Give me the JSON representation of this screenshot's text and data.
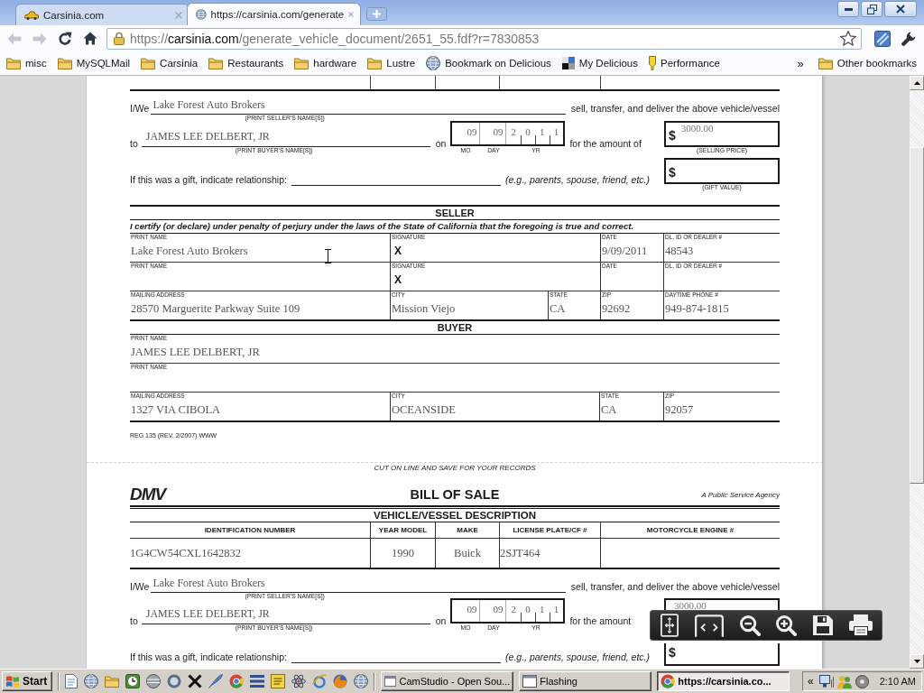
{
  "browser": {
    "tabs": [
      {
        "title": "Carsinia.com",
        "kind": "car",
        "selected": false
      },
      {
        "title": "https://carsinia.com/generate",
        "kind": "globe",
        "selected": true
      }
    ],
    "navigation": {
      "back": {
        "disabled": true
      },
      "forward": {
        "disabled": true
      }
    },
    "address": {
      "scheme": "https://",
      "host": "carsinia.com",
      "path": "/generate_vehicle_document/2651_55.fdf?r=7830853"
    },
    "bookmarks": [
      {
        "label": "misc",
        "kind": "folder"
      },
      {
        "label": "MySQLMail",
        "kind": "folder"
      },
      {
        "label": "Carsinia",
        "kind": "folder"
      },
      {
        "label": "Restaurants",
        "kind": "folder"
      },
      {
        "label": "hardware",
        "kind": "folder"
      },
      {
        "label": "Lustre",
        "kind": "folder"
      },
      {
        "label": "Bookmark on Delicious",
        "kind": "globe"
      },
      {
        "label": "My Delicious",
        "kind": "squares"
      },
      {
        "label": "Performance",
        "kind": "marker"
      }
    ],
    "more_bookmarks": "»",
    "other_bookmarks": "Other bookmarks"
  },
  "document": {
    "top_copy": {
      "transfer": {
        "iwe": "I/We",
        "seller_name": "Lake Forest Auto Brokers",
        "seller_caption": "(PRINT SELLER'S NAME[S])",
        "sell_text": "sell, transfer, and deliver the above vehicle/vessel",
        "to": "to",
        "buyer_name": "JAMES LEE DELBERT, JR",
        "buyer_caption": "(PRINT BUYER'S NAME[S])",
        "on": "on",
        "date": {
          "month": "09",
          "day": "09",
          "year": [
            "2",
            "0",
            "1",
            "1"
          ]
        },
        "date_captions": [
          "MO",
          "DAY",
          "YR"
        ],
        "amount_text": "for the amount of",
        "currency": "$",
        "price": "3000.00",
        "price_caption": "(SELLING PRICE)",
        "gift_text": "If this was a gift, indicate relationship:",
        "gift_hint": "(e.g., parents, spouse, friend, etc.)",
        "gift_currency": "$",
        "gift_caption": "(GIFT VALUE)"
      },
      "seller": {
        "heading": "SELLER",
        "certify": "I certify (or declare) under penalty of perjury under the laws of the State of California that the foregoing is true and correct.",
        "signers": [
          {
            "cells": [
              {
                "label": "PRINT NAME",
                "value": "Lake Forest Auto Brokers"
              },
              {
                "label": "SIGNATURE",
                "mark": "X"
              },
              {
                "label": "DATE",
                "value": "9/09/2011"
              },
              {
                "label": "DL, ID OR DEALER #",
                "value": "48543"
              }
            ]
          },
          {
            "cells": [
              {
                "label": "PRINT NAME"
              },
              {
                "label": "SIGNATURE",
                "mark": "X"
              },
              {
                "label": "DATE"
              },
              {
                "label": "DL, ID OR DEALER #"
              }
            ]
          }
        ],
        "address": {
          "cells": [
            {
              "label": "MAILING ADDRESS",
              "value": "28570 Marguerite Parkway Suite 109"
            },
            {
              "label": "CITY",
              "value": "Mission Viejo"
            },
            {
              "label": "STATE",
              "value": "CA"
            },
            {
              "label": "ZIP",
              "value": "92692"
            },
            {
              "label": "DAYTIME PHONE #",
              "value": "949-874-1815"
            }
          ]
        }
      },
      "buyer": {
        "heading": "BUYER",
        "names": [
          {
            "cells": [
              {
                "label": "PRINT NAME",
                "value": "JAMES LEE DELBERT, JR"
              }
            ]
          },
          {
            "cells": [
              {
                "label": "PRINT NAME"
              }
            ]
          }
        ],
        "address": {
          "cells": [
            {
              "label": "MAILING ADDRESS",
              "value": "1327 VIA CIBOLA"
            },
            {
              "label": "CITY",
              "value": "OCEANSIDE"
            },
            {
              "label": "STATE",
              "value": "CA"
            },
            {
              "label": "ZIP",
              "value": "92057"
            }
          ]
        }
      },
      "form_number": "REG 135 (REV. 2/2007) WWW"
    },
    "cut_line": "CUT ON LINE AND SAVE FOR YOUR RECORDS",
    "bottom_copy": {
      "logo": "DMV",
      "title": "BILL OF SALE",
      "agency": "A Public Service Agency",
      "vehicle": {
        "heading": "VEHICLE/VESSEL DESCRIPTION",
        "columns": [
          "IDENTIFICATION NUMBER",
          "YEAR MODEL",
          "MAKE",
          "LICENSE PLATE/CF #",
          "MOTORCYCLE ENGINE #"
        ],
        "rows": [
          [
            "1G4CW54CXL1642832",
            "1990",
            "Buick",
            "2SJT464"
          ]
        ]
      },
      "transfer": {
        "iwe": "I/We",
        "seller_name": "Lake Forest Auto Brokers",
        "seller_caption": "(PRINT SELLER'S NAME[S])",
        "sell_text": "sell, transfer, and deliver the above vehicle/vessel",
        "to": "to",
        "buyer_name": "JAMES LEE DELBERT, JR",
        "buyer_caption": "(PRINT BUYER'S NAME[S])",
        "on": "on",
        "date": {
          "month": "09",
          "day": "09",
          "year": [
            "2",
            "0",
            "1",
            "1"
          ]
        },
        "date_captions": [
          "MO",
          "DAY",
          "YR"
        ],
        "amount_text": "for the amount",
        "price": "3000.00",
        "gift_text": "If this was a gift, indicate relationship:",
        "gift_hint": "(e.g., parents, spouse, friend, etc.)",
        "gift_currency": "$"
      }
    }
  },
  "taskbar": {
    "start": "Start",
    "tasks": [
      {
        "label": "CamStudio - Open Sou...",
        "kind": "window",
        "selected": false
      },
      {
        "label": "Flashing",
        "kind": "window",
        "selected": false
      },
      {
        "label": "https://carsinia.co...",
        "kind": "browser",
        "selected": true
      }
    ],
    "tray_toggle": "«",
    "clock": "2:10 AM"
  }
}
